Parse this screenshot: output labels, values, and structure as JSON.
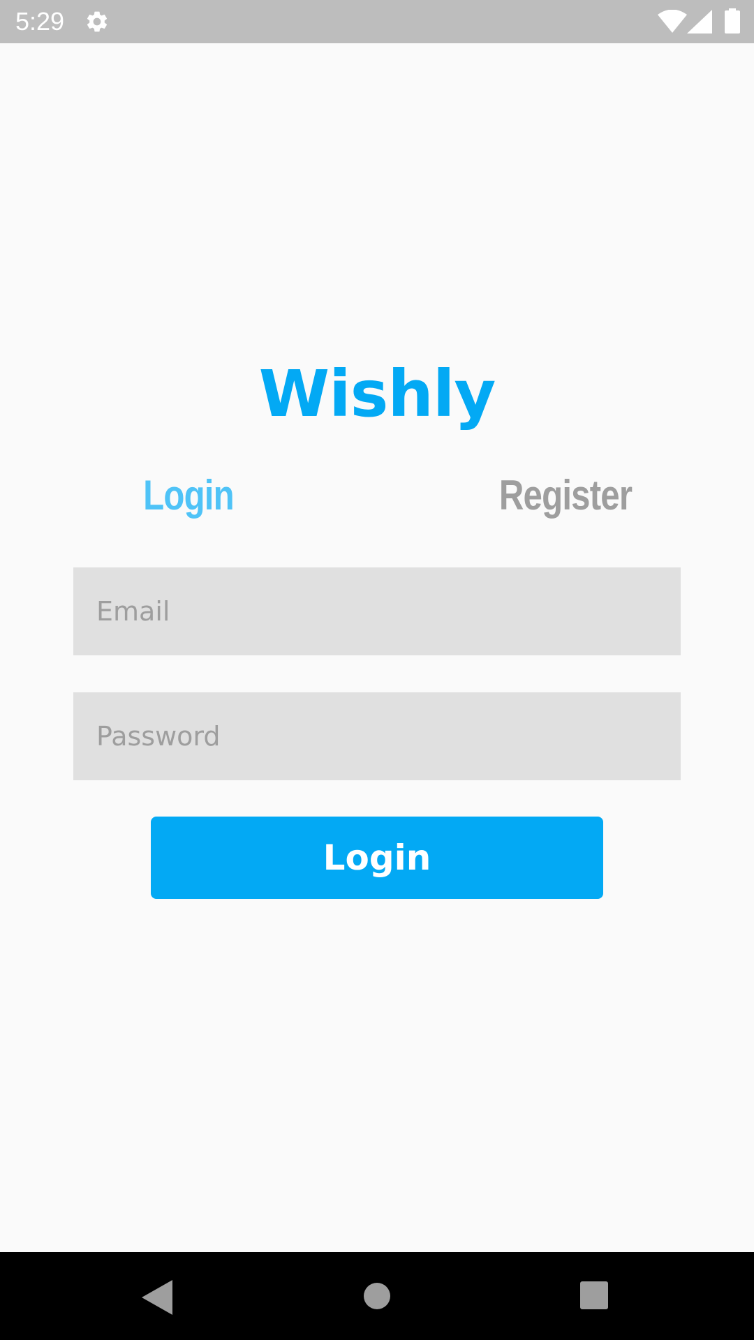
{
  "status_bar": {
    "time": "5:29",
    "icons": [
      "gear-icon",
      "wifi-icon",
      "signal-icon",
      "battery-icon"
    ]
  },
  "app": {
    "title": "Wishly"
  },
  "tabs": [
    {
      "label": "Login",
      "active": true
    },
    {
      "label": "Register",
      "active": false
    }
  ],
  "form": {
    "email": {
      "placeholder": "Email",
      "value": ""
    },
    "password": {
      "placeholder": "Password",
      "value": ""
    },
    "submit_label": "Login"
  },
  "nav_bar": {
    "icons": [
      "back-icon",
      "home-icon",
      "recents-icon"
    ]
  },
  "colors": {
    "brand": "#03A9F4",
    "tab_active": "#4FC3F7",
    "tab_inactive": "#9E9E9E",
    "field_bg": "#E0E0E0",
    "status_bar": "#BDBDBD",
    "background": "#FAFAFA"
  }
}
